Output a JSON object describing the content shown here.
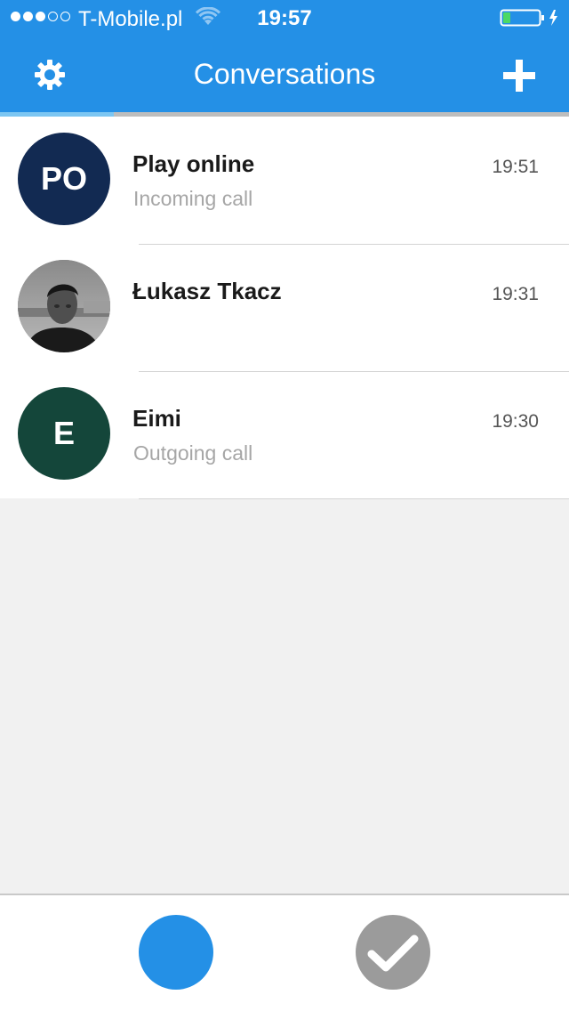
{
  "status_bar": {
    "signal_filled": 3,
    "signal_total": 5,
    "carrier": "T-Mobile.pl",
    "time": "19:57",
    "battery_level": 0.2,
    "charging": true
  },
  "nav": {
    "title": "Conversations",
    "left_icon": "gear-icon",
    "right_icon": "plus-icon",
    "active_tab_fraction": 0.2
  },
  "conversations": [
    {
      "initials": "PO",
      "avatar_color": "#122a52",
      "name": "Play online",
      "time": "19:51",
      "subtitle": "Incoming call"
    },
    {
      "initials": "",
      "avatar_color": "#6b6b6b",
      "avatar_type": "photo",
      "name": "Łukasz Tkacz",
      "time": "19:31",
      "subtitle": ""
    },
    {
      "initials": "E",
      "avatar_color": "#14463a",
      "name": "Eimi",
      "time": "19:30",
      "subtitle": "Outgoing call"
    }
  ],
  "tab_bar": {
    "left_color": "#2490e6",
    "right_color": "#9b9b9b",
    "right_icon": "checkmark-icon"
  },
  "colors": {
    "accent": "#2490e6",
    "background": "#f1f1f1",
    "subtitle": "#a6a6a6"
  }
}
